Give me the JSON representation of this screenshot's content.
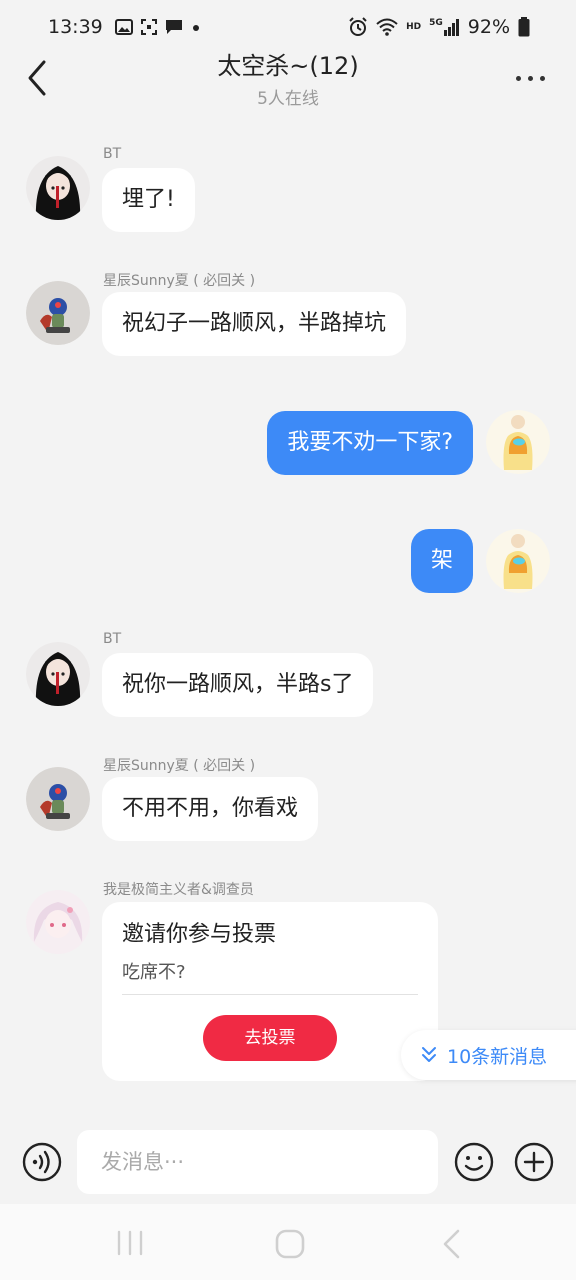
{
  "status_bar": {
    "time": "13:39",
    "hd_label": "HD",
    "net_label": "5G",
    "battery": "92%"
  },
  "header": {
    "title": "太空杀~(12)",
    "subtitle": "5人在线"
  },
  "messages": [
    {
      "sender": "BT",
      "text": "埋了!"
    },
    {
      "sender": "星辰Sunny夏 ( 必回关 )",
      "text": "祝幻子一路顺风，半路掉坑"
    },
    {
      "text": "我要不劝一下家?"
    },
    {
      "text": "架"
    },
    {
      "sender": "BT",
      "text": "祝你一路顺风，半路s了"
    },
    {
      "sender": "星辰Sunny夏 ( 必回关 )",
      "text": "不用不用，你看戏"
    }
  ],
  "vote": {
    "sender": "我是极简主义者&调查员",
    "title": "邀请你参与投票",
    "question": "吃席不?",
    "button": "去投票"
  },
  "new_messages": {
    "label": "10条新消息"
  },
  "input": {
    "placeholder": "发消息···"
  },
  "colors": {
    "accent": "#3d8af7",
    "vote_button": "#f02a44",
    "background": "#f3f3f3"
  },
  "icons": {
    "back": "chevron-left-icon",
    "more": "more-dots-icon",
    "voice": "voice-icon",
    "emoji": "emoji-icon",
    "plus": "plus-icon",
    "new_messages": "double-chevron-down-icon"
  }
}
